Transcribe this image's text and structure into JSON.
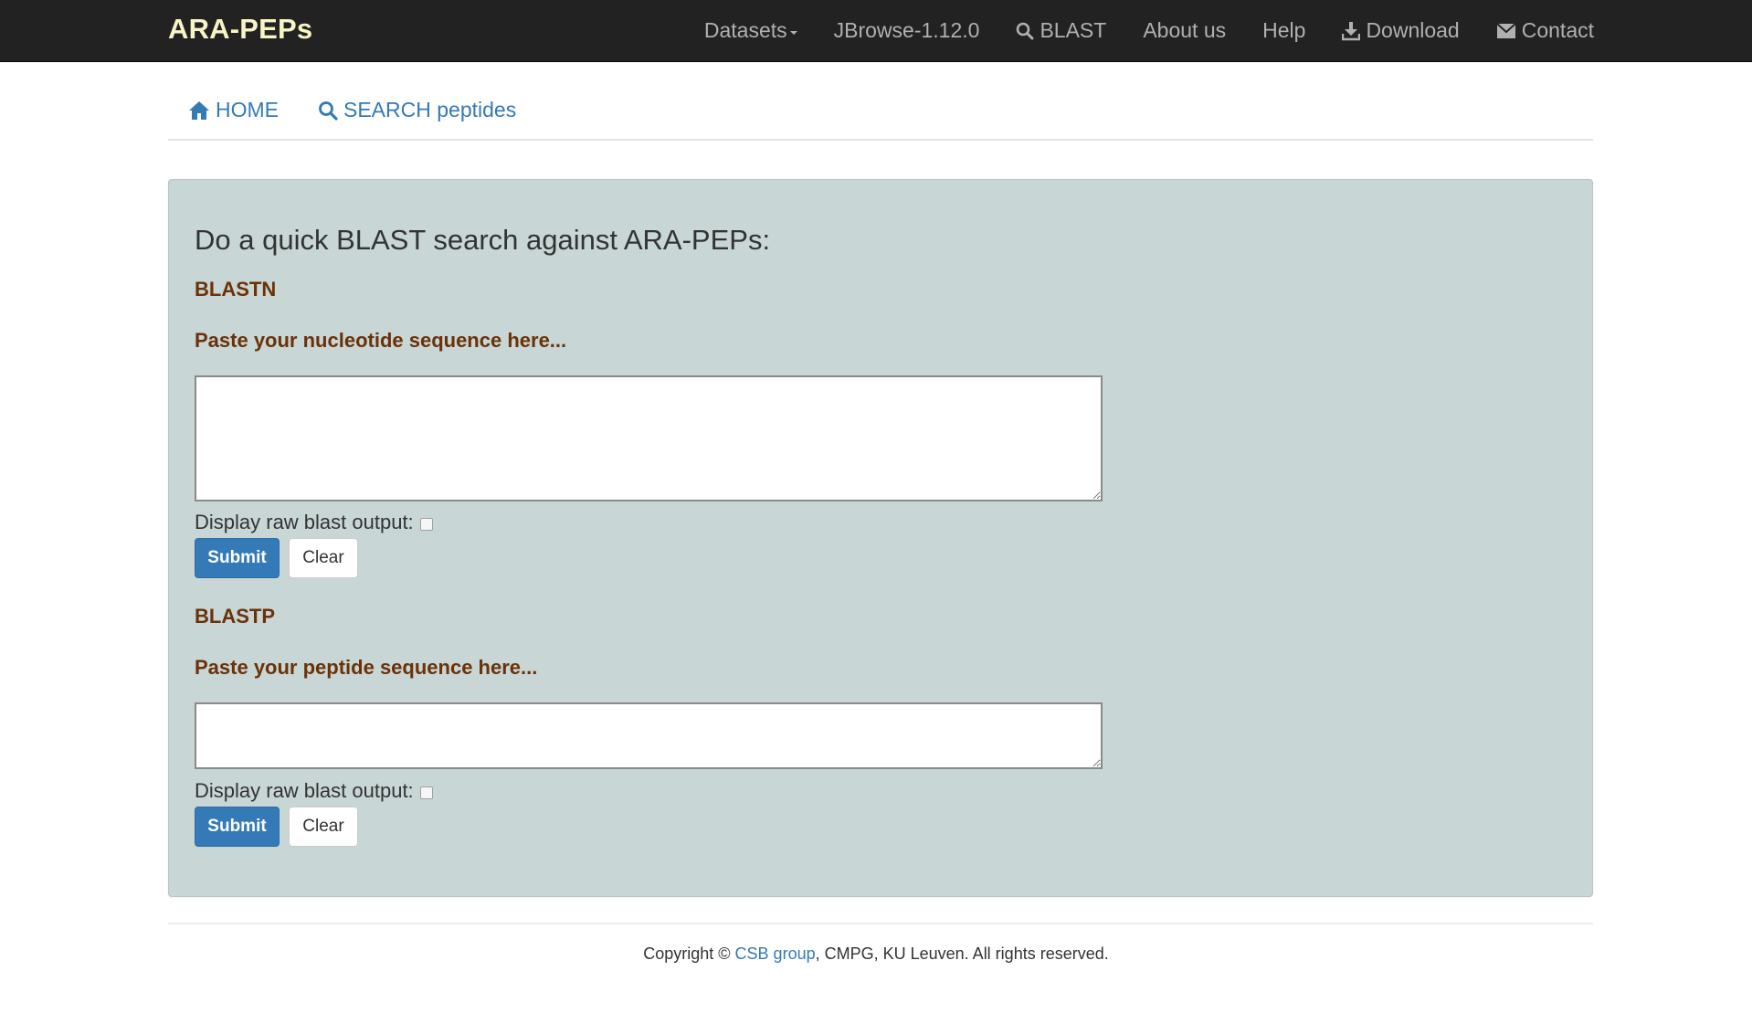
{
  "nav": {
    "brand": "ARA-PEPs",
    "datasets": "Datasets",
    "jbrowse": "JBrowse-1.12.0",
    "blast": "BLAST",
    "about": "About us",
    "help": "Help",
    "download": "Download",
    "contact": "Contact"
  },
  "tabs": {
    "home": "HOME",
    "search": "SEARCH peptides"
  },
  "panel": {
    "heading": "Do a quick BLAST search against ARA-PEPs:",
    "blastn": {
      "title": "BLASTN",
      "prompt": "Paste your nucleotide sequence here...",
      "textarea_value": "",
      "raw_label": "Display raw blast output:",
      "raw_checked": false,
      "submit": "Submit",
      "clear": "Clear"
    },
    "blastp": {
      "title": "BLASTP",
      "prompt": "Paste your peptide sequence here...",
      "textarea_value": "",
      "raw_label": "Display raw blast output:",
      "raw_checked": false,
      "submit": "Submit",
      "clear": "Clear"
    }
  },
  "footer": {
    "prefix": "Copyright © ",
    "link": "CSB group",
    "suffix": ", CMPG, KU Leuven. All rights reserved."
  },
  "colors": {
    "navbar_bg": "#222222",
    "brand": "#f7f5c6",
    "link": "#337ab7",
    "panel_bg": "#c8d6d6",
    "section_title": "#6b3208",
    "primary_button": "#337ab7"
  },
  "icons": {
    "blast": "search-icon",
    "download": "download-icon",
    "contact": "envelope-icon",
    "home": "home-icon",
    "search_tab": "search-icon"
  }
}
